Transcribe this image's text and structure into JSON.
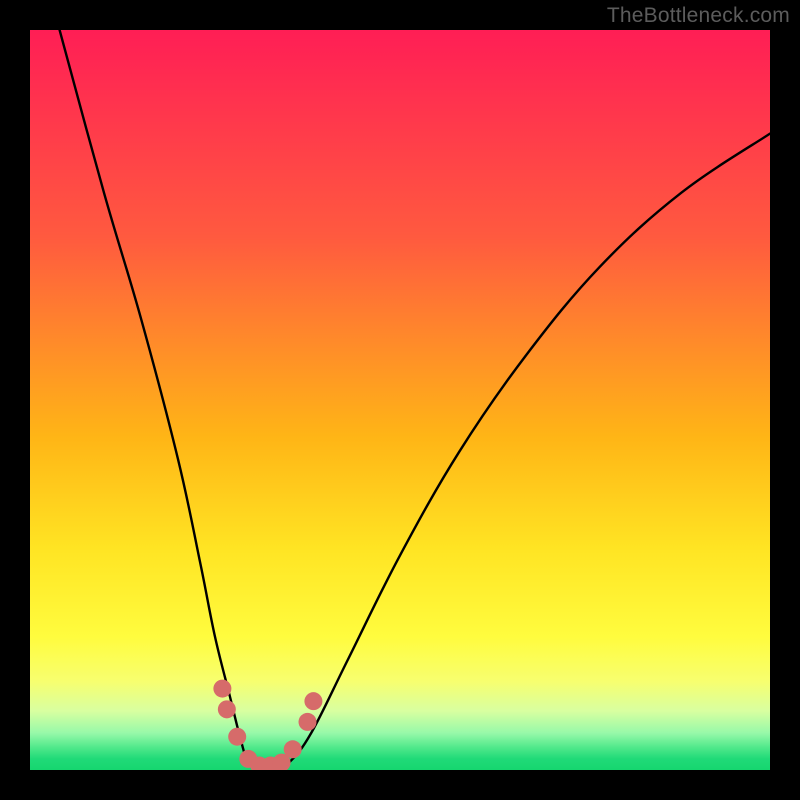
{
  "watermark": "TheBottleneck.com",
  "chart_data": {
    "type": "line",
    "title": "",
    "xlabel": "",
    "ylabel": "",
    "xlim": [
      0,
      100
    ],
    "ylim": [
      0,
      100
    ],
    "series": [
      {
        "name": "bottleneck-curve",
        "x": [
          4,
          10,
          15,
          20,
          23,
          25,
          27,
          28.5,
          29.5,
          31,
          33,
          35,
          38,
          43,
          50,
          58,
          67,
          77,
          88,
          100
        ],
        "y": [
          100,
          78,
          61,
          42,
          28,
          18,
          10,
          4,
          1,
          0,
          0,
          1,
          5,
          15,
          29,
          43,
          56,
          68,
          78,
          86
        ]
      }
    ],
    "markers": {
      "name": "highlight-dots",
      "color": "#d66b6a",
      "points": [
        {
          "x": 26.0,
          "y": 11.0
        },
        {
          "x": 26.6,
          "y": 8.2
        },
        {
          "x": 28.0,
          "y": 4.5
        },
        {
          "x": 29.5,
          "y": 1.5
        },
        {
          "x": 31.0,
          "y": 0.6
        },
        {
          "x": 32.5,
          "y": 0.6
        },
        {
          "x": 34.0,
          "y": 1.0
        },
        {
          "x": 35.5,
          "y": 2.8
        },
        {
          "x": 37.5,
          "y": 6.5
        },
        {
          "x": 38.3,
          "y": 9.3
        }
      ]
    },
    "background_gradient": {
      "direction": "vertical",
      "stops": [
        {
          "pos": 0.0,
          "color": "#ff1e55"
        },
        {
          "pos": 0.28,
          "color": "#ff5a3f"
        },
        {
          "pos": 0.55,
          "color": "#ffb516"
        },
        {
          "pos": 0.82,
          "color": "#fffc3e"
        },
        {
          "pos": 0.95,
          "color": "#97f9a9"
        },
        {
          "pos": 1.0,
          "color": "#16d66f"
        }
      ]
    }
  }
}
